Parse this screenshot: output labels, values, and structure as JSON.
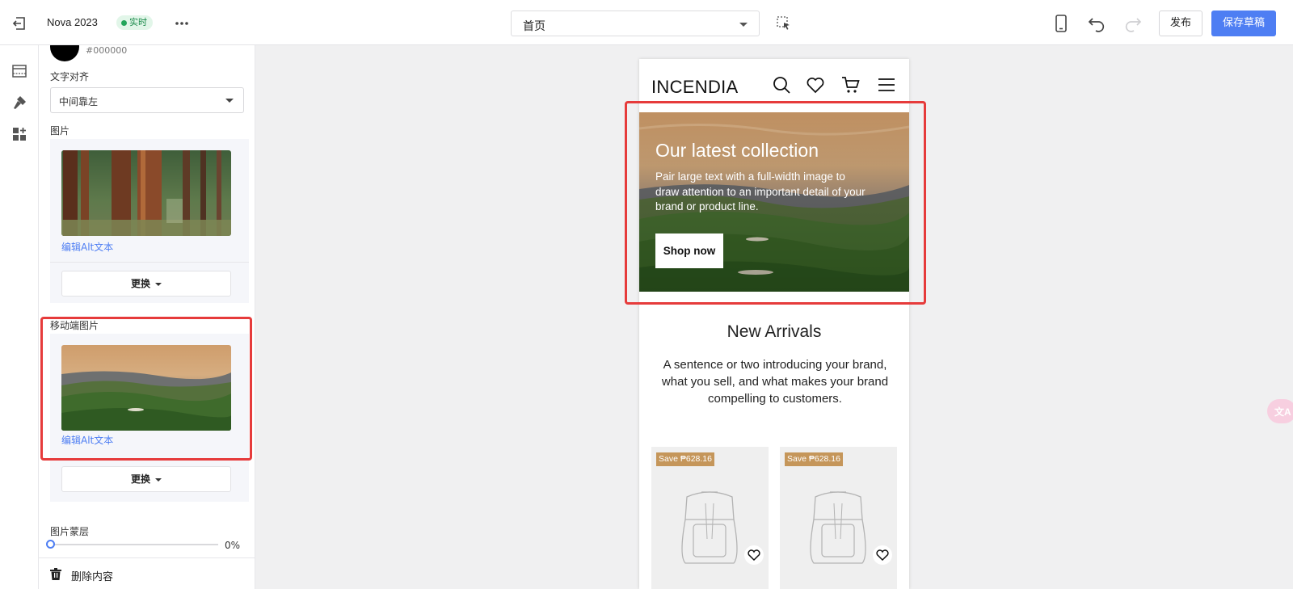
{
  "topbar": {
    "store_name": "Nova 2023",
    "live_badge": "实时",
    "page_select": "首页",
    "publish_label": "发布",
    "save_draft_label": "保存草稿"
  },
  "panel": {
    "color_hex": "#000000",
    "text_align_label": "文字对齐",
    "text_align_value": "中间靠左",
    "image_label": "图片",
    "edit_alt_label": "编辑Alt文本",
    "replace_label": "更换",
    "mobile_image_label": "移动端图片",
    "mobile_edit_alt_label": "编辑Alt文本",
    "mobile_replace_label": "更换",
    "overlay_label": "图片蒙层",
    "overlay_value": "0%",
    "overlay_level": 0,
    "delete_label": "删除内容"
  },
  "preview": {
    "logo": "INCENDIA",
    "hero": {
      "title": "Our latest collection",
      "text": "Pair large text with a full-width image to draw attention to an important detail of your brand or product line.",
      "button": "Shop now"
    },
    "new_arrivals": {
      "title": "New Arrivals",
      "text": "A sentence or two introducing your brand, what you sell, and what makes your brand compelling to customers."
    },
    "products": [
      {
        "badge": "Save ₱628.16"
      },
      {
        "badge": "Save ₱628.16"
      }
    ]
  },
  "translate_fab": "文A",
  "colors": {
    "accent": "#4e7ef3",
    "highlight": "#e63b3b",
    "live": "#22a55a",
    "badge": "#c5965a"
  },
  "icons": {
    "exit": "exit-icon",
    "more": "more-icon",
    "select": "select-element-icon",
    "mobile": "mobile-view-icon",
    "undo": "undo-icon",
    "redo": "redo-icon",
    "rail": [
      "sections-icon",
      "theme-style-icon",
      "apps-icon"
    ],
    "preview": [
      "search-icon",
      "heart-icon",
      "cart-icon",
      "menu-icon"
    ]
  }
}
